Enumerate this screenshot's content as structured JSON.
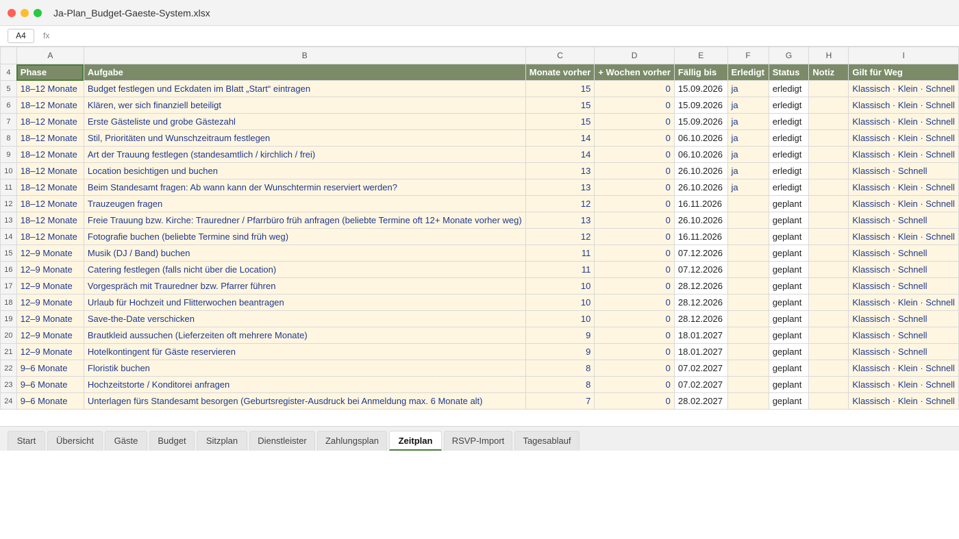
{
  "window": {
    "title": "Ja-Plan_Budget-Gaeste-System.xlsx"
  },
  "formula_bar": {
    "cell_ref": "A4",
    "fx_label": "fx"
  },
  "columns": [
    "A",
    "B",
    "C",
    "D",
    "E",
    "F",
    "G",
    "H",
    "I"
  ],
  "header_row": {
    "row_number": "4",
    "cells": [
      "Phase",
      "Aufgabe",
      "Monate vorher",
      "+ Wochen vorher",
      "Fällig bis",
      "Erledigt",
      "Status",
      "Notiz",
      "Gilt für Weg"
    ]
  },
  "rows": [
    {
      "n": "5",
      "phase": "18–12 Monate",
      "task": "Budget festlegen und Eckdaten im Blatt „Start“ eintragen",
      "months": "15",
      "weeks": "0",
      "due": "15.09.2026",
      "done": "ja",
      "status": "erledigt",
      "note": "",
      "way": "Klassisch · Klein · Schnell"
    },
    {
      "n": "6",
      "phase": "18–12 Monate",
      "task": "Klären, wer sich finanziell beteiligt",
      "months": "15",
      "weeks": "0",
      "due": "15.09.2026",
      "done": "ja",
      "status": "erledigt",
      "note": "",
      "way": "Klassisch · Klein · Schnell"
    },
    {
      "n": "7",
      "phase": "18–12 Monate",
      "task": "Erste Gästeliste und grobe Gästezahl",
      "months": "15",
      "weeks": "0",
      "due": "15.09.2026",
      "done": "ja",
      "status": "erledigt",
      "note": "",
      "way": "Klassisch · Klein · Schnell"
    },
    {
      "n": "8",
      "phase": "18–12 Monate",
      "task": "Stil, Prioritäten und Wunschzeitraum festlegen",
      "months": "14",
      "weeks": "0",
      "due": "06.10.2026",
      "done": "ja",
      "status": "erledigt",
      "note": "",
      "way": "Klassisch · Klein · Schnell"
    },
    {
      "n": "9",
      "phase": "18–12 Monate",
      "task": "Art der Trauung festlegen (standesamtlich / kirchlich / frei)",
      "months": "14",
      "weeks": "0",
      "due": "06.10.2026",
      "done": "ja",
      "status": "erledigt",
      "note": "",
      "way": "Klassisch · Klein · Schnell"
    },
    {
      "n": "10",
      "phase": "18–12 Monate",
      "task": "Location besichtigen und buchen",
      "months": "13",
      "weeks": "0",
      "due": "26.10.2026",
      "done": "ja",
      "status": "erledigt",
      "note": "",
      "way": "Klassisch · Schnell"
    },
    {
      "n": "11",
      "phase": "18–12 Monate",
      "task": "Beim Standesamt fragen: Ab wann kann der Wunschtermin reserviert werden?",
      "months": "13",
      "weeks": "0",
      "due": "26.10.2026",
      "done": "ja",
      "status": "erledigt",
      "note": "",
      "way": "Klassisch · Klein · Schnell"
    },
    {
      "n": "12",
      "phase": "18–12 Monate",
      "task": "Trauzeugen fragen",
      "months": "12",
      "weeks": "0",
      "due": "16.11.2026",
      "done": "",
      "status": "geplant",
      "note": "",
      "way": "Klassisch · Klein · Schnell"
    },
    {
      "n": "13",
      "phase": "18–12 Monate",
      "task": "Freie Trauung bzw. Kirche: Trauredner / Pfarrbüro früh anfragen (beliebte Termine oft 12+ Monate vorher weg)",
      "months": "13",
      "weeks": "0",
      "due": "26.10.2026",
      "done": "",
      "status": "geplant",
      "note": "",
      "way": "Klassisch · Schnell"
    },
    {
      "n": "14",
      "phase": "18–12 Monate",
      "task": "Fotografie buchen (beliebte Termine sind früh weg)",
      "months": "12",
      "weeks": "0",
      "due": "16.11.2026",
      "done": "",
      "status": "geplant",
      "note": "",
      "way": "Klassisch · Klein · Schnell"
    },
    {
      "n": "15",
      "phase": "12–9 Monate",
      "task": "Musik (DJ / Band) buchen",
      "months": "11",
      "weeks": "0",
      "due": "07.12.2026",
      "done": "",
      "status": "geplant",
      "note": "",
      "way": "Klassisch · Schnell"
    },
    {
      "n": "16",
      "phase": "12–9 Monate",
      "task": "Catering festlegen (falls nicht über die Location)",
      "months": "11",
      "weeks": "0",
      "due": "07.12.2026",
      "done": "",
      "status": "geplant",
      "note": "",
      "way": "Klassisch · Schnell"
    },
    {
      "n": "17",
      "phase": "12–9 Monate",
      "task": "Vorgespräch mit Trauredner bzw. Pfarrer führen",
      "months": "10",
      "weeks": "0",
      "due": "28.12.2026",
      "done": "",
      "status": "geplant",
      "note": "",
      "way": "Klassisch · Schnell"
    },
    {
      "n": "18",
      "phase": "12–9 Monate",
      "task": "Urlaub für Hochzeit und Flitterwochen beantragen",
      "months": "10",
      "weeks": "0",
      "due": "28.12.2026",
      "done": "",
      "status": "geplant",
      "note": "",
      "way": "Klassisch · Klein · Schnell"
    },
    {
      "n": "19",
      "phase": "12–9 Monate",
      "task": "Save-the-Date verschicken",
      "months": "10",
      "weeks": "0",
      "due": "28.12.2026",
      "done": "",
      "status": "geplant",
      "note": "",
      "way": "Klassisch · Schnell"
    },
    {
      "n": "20",
      "phase": "12–9 Monate",
      "task": "Brautkleid aussuchen (Lieferzeiten oft mehrere Monate)",
      "months": "9",
      "weeks": "0",
      "due": "18.01.2027",
      "done": "",
      "status": "geplant",
      "note": "",
      "way": "Klassisch · Schnell"
    },
    {
      "n": "21",
      "phase": "12–9 Monate",
      "task": "Hotelkontingent für Gäste reservieren",
      "months": "9",
      "weeks": "0",
      "due": "18.01.2027",
      "done": "",
      "status": "geplant",
      "note": "",
      "way": "Klassisch · Schnell"
    },
    {
      "n": "22",
      "phase": "9–6 Monate",
      "task": "Floristik buchen",
      "months": "8",
      "weeks": "0",
      "due": "07.02.2027",
      "done": "",
      "status": "geplant",
      "note": "",
      "way": "Klassisch · Klein · Schnell"
    },
    {
      "n": "23",
      "phase": "9–6 Monate",
      "task": "Hochzeitstorte / Konditorei anfragen",
      "months": "8",
      "weeks": "0",
      "due": "07.02.2027",
      "done": "",
      "status": "geplant",
      "note": "",
      "way": "Klassisch · Klein · Schnell"
    },
    {
      "n": "24",
      "phase": "9–6 Monate",
      "task": "Unterlagen fürs Standesamt besorgen (Geburtsregister-Ausdruck bei Anmeldung max. 6 Monate alt)",
      "months": "7",
      "weeks": "0",
      "due": "28.02.2027",
      "done": "",
      "status": "geplant",
      "note": "",
      "way": "Klassisch · Klein · Schnell"
    }
  ],
  "sheet_tabs": [
    "Start",
    "Übersicht",
    "Gäste",
    "Budget",
    "Sitzplan",
    "Dienstleister",
    "Zahlungsplan",
    "Zeitplan",
    "RSVP-Import",
    "Tagesablauf"
  ],
  "active_tab": "Zeitplan",
  "colors": {
    "header_bg": "#7b8b68",
    "cell_bg": "#fef6e1",
    "cell_text": "#20398e",
    "active_accent": "#4a7a3a"
  }
}
